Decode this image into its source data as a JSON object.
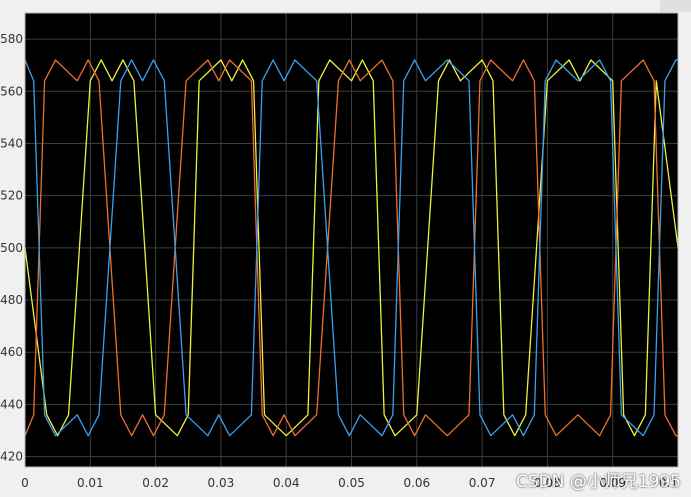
{
  "window": {
    "background": "#f0f0f0"
  },
  "chart_data": {
    "type": "line",
    "title": "",
    "xlabel": "",
    "ylabel": "",
    "xlim": [
      0,
      0.1
    ],
    "ylim": [
      416,
      590
    ],
    "grid": true,
    "legend": "none",
    "x_ticks": [
      0,
      0.01,
      0.02,
      0.03,
      0.04,
      0.05,
      0.06,
      0.07,
      0.08,
      0.09,
      0.1
    ],
    "x_tick_labels": [
      "0",
      "0.01",
      "0.02",
      "0.03",
      "0.04",
      "0.05",
      "0.06",
      "0.07",
      "0.08",
      "0.09",
      "0.1"
    ],
    "y_ticks": [
      420,
      440,
      460,
      480,
      500,
      520,
      540,
      560,
      580
    ],
    "y_tick_labels": [
      "420",
      "440",
      "460",
      "480",
      "500",
      "520",
      "540",
      "560",
      "580"
    ],
    "colors": {
      "plot_background": "#000000",
      "grid": "#3d3d3d",
      "frame": "#b5b5b5"
    },
    "series": [
      {
        "color": "#f0f03a",
        "x": [
          0,
          0.00333,
          0.005,
          0.00667,
          0.01,
          0.01167,
          0.01333,
          0.015,
          0.01667,
          0.02,
          0.02333,
          0.025,
          0.02667,
          0.03,
          0.03167,
          0.03333,
          0.035,
          0.03667,
          0.04,
          0.04333,
          0.045,
          0.04667,
          0.05,
          0.05167,
          0.05333,
          0.055,
          0.05667,
          0.06,
          0.06333,
          0.065,
          0.06667,
          0.07,
          0.07167,
          0.07333,
          0.075,
          0.07667,
          0.08,
          0.08333,
          0.085,
          0.08667,
          0.09,
          0.09167,
          0.09333,
          0.095,
          0.09667,
          0.1
        ],
        "y": [
          500,
          436,
          428,
          436,
          564,
          572,
          564,
          572,
          564,
          436,
          428,
          436,
          564,
          572,
          564,
          572,
          564,
          436,
          428,
          436,
          564,
          572,
          564,
          572,
          564,
          436,
          428,
          436,
          564,
          572,
          564,
          572,
          564,
          436,
          428,
          436,
          564,
          572,
          564,
          572,
          564,
          436,
          428,
          436,
          564,
          500
        ]
      },
      {
        "color": "#ed6f2f",
        "x": [
          0,
          0.00133,
          0.003,
          0.00467,
          0.008,
          0.00967,
          0.01133,
          0.01467,
          0.01633,
          0.018,
          0.01967,
          0.02133,
          0.02467,
          0.028,
          0.02967,
          0.03133,
          0.03467,
          0.03633,
          0.038,
          0.03967,
          0.04133,
          0.04467,
          0.048,
          0.04967,
          0.05133,
          0.05467,
          0.05633,
          0.058,
          0.05967,
          0.06133,
          0.06467,
          0.068,
          0.06967,
          0.07133,
          0.07467,
          0.07633,
          0.078,
          0.07967,
          0.08133,
          0.08467,
          0.088,
          0.08967,
          0.09133,
          0.09467,
          0.09633,
          0.098,
          0.09967,
          0.1
        ],
        "y": [
          428,
          436,
          564,
          572,
          564,
          572,
          564,
          436,
          428,
          436,
          428,
          436,
          564,
          572,
          564,
          572,
          564,
          436,
          428,
          436,
          428,
          436,
          564,
          572,
          564,
          572,
          564,
          436,
          428,
          436,
          428,
          436,
          564,
          572,
          564,
          572,
          564,
          436,
          428,
          436,
          428,
          436,
          564,
          572,
          564,
          436,
          428,
          428
        ]
      },
      {
        "color": "#3d9eea",
        "x": [
          0,
          0.00133,
          0.003,
          0.00467,
          0.008,
          0.00967,
          0.01133,
          0.01467,
          0.01633,
          0.018,
          0.01967,
          0.02133,
          0.02467,
          0.028,
          0.02967,
          0.03133,
          0.03467,
          0.03633,
          0.038,
          0.03967,
          0.04133,
          0.04467,
          0.048,
          0.04967,
          0.05133,
          0.05467,
          0.05633,
          0.058,
          0.05967,
          0.06133,
          0.06467,
          0.068,
          0.06967,
          0.07133,
          0.07467,
          0.07633,
          0.078,
          0.07967,
          0.08133,
          0.08467,
          0.088,
          0.08967,
          0.09133,
          0.09467,
          0.09633,
          0.098,
          0.09967,
          0.1
        ],
        "y": [
          572,
          564,
          436,
          428,
          436,
          428,
          436,
          564,
          572,
          564,
          572,
          564,
          436,
          428,
          436,
          428,
          436,
          564,
          572,
          564,
          572,
          564,
          436,
          428,
          436,
          428,
          436,
          564,
          572,
          564,
          572,
          564,
          436,
          428,
          436,
          428,
          436,
          564,
          572,
          564,
          572,
          564,
          436,
          428,
          436,
          564,
          572,
          572
        ]
      }
    ]
  },
  "watermark": {
    "text": "CSDN @小师兄1995"
  }
}
